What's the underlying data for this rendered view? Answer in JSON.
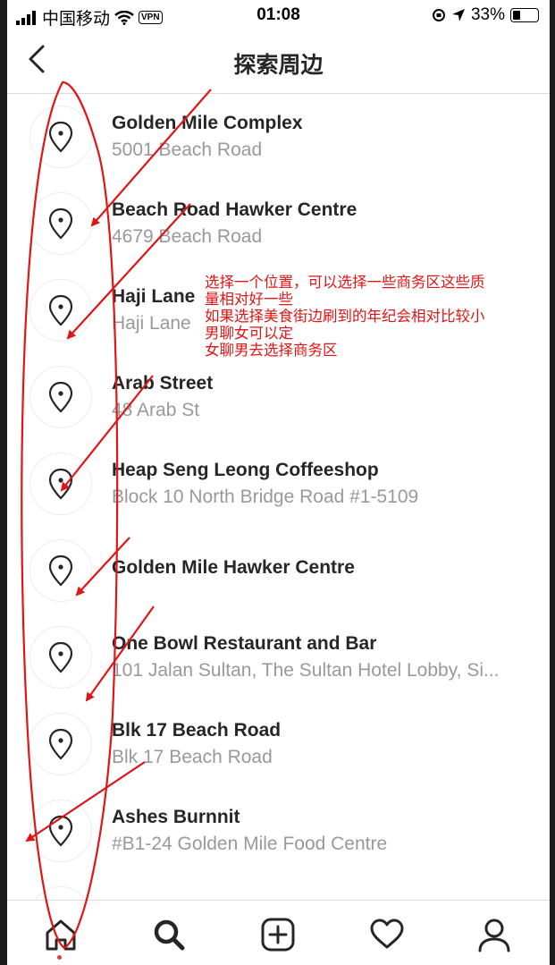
{
  "status_bar": {
    "carrier": "中国移动",
    "vpn": "VPN",
    "time": "01:08",
    "battery": "33%",
    "battery_level": 0.33
  },
  "header": {
    "title": "探索周边"
  },
  "places": [
    {
      "name": "Golden Mile Complex",
      "address": "5001 Beach Road"
    },
    {
      "name": "Beach Road Hawker Centre",
      "address": "4679 Beach Road"
    },
    {
      "name": "Haji Lane",
      "address": "Haji Lane"
    },
    {
      "name": "Arab Street",
      "address": "48 Arab St"
    },
    {
      "name": "Heap Seng Leong Coffeeshop",
      "address": "Block 10 North Bridge Road #1-5109"
    },
    {
      "name": "Golden Mile Hawker Centre",
      "address": ""
    },
    {
      "name": "One Bowl Restaurant and Bar",
      "address": "101 Jalan Sultan, The Sultan Hotel Lobby, Si..."
    },
    {
      "name": "Blk 17 Beach Road",
      "address": "Blk 17 Beach Road"
    },
    {
      "name": "Ashes Burnnit",
      "address": "#B1-24 Golden Mile Food Centre"
    }
  ],
  "annotation": {
    "lines": [
      "选择一个位置，可以选择一些商务区这些质",
      "量相对好一些",
      "如果选择美食街边刷到的年纪会相对比较小",
      "男聊女可以定",
      "女聊男去选择商务区"
    ],
    "color": "#e01515"
  },
  "tab_bar": {
    "tabs": [
      "home-icon",
      "search-icon",
      "add-post-icon",
      "activity-heart-icon",
      "profile-icon"
    ]
  }
}
